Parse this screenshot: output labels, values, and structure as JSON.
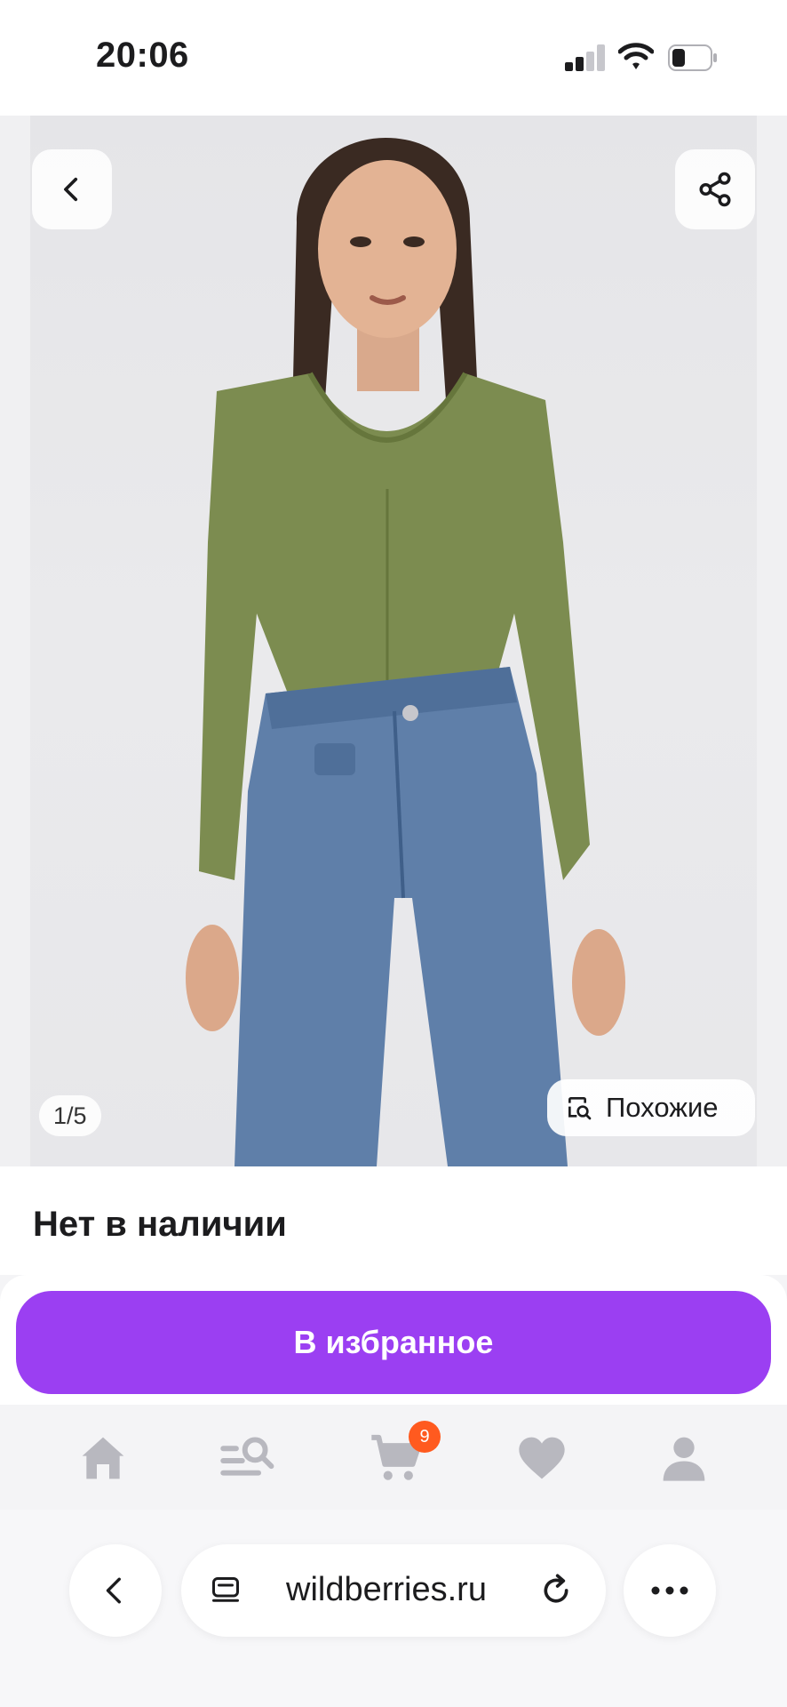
{
  "status_bar": {
    "time": "20:06"
  },
  "gallery": {
    "pager": "1/5",
    "similar_label": "Похожие"
  },
  "product": {
    "availability": "Нет в наличии"
  },
  "actions": {
    "favorite_label": "В избранное"
  },
  "app_nav": {
    "items": [
      "home-icon",
      "catalog-search-icon",
      "cart-icon",
      "heart-icon",
      "profile-icon"
    ],
    "cart_count": "9"
  },
  "browser": {
    "url": "wildberries.ru"
  },
  "colors": {
    "accent": "#9b3ff2",
    "badge": "#ff5a1f"
  }
}
